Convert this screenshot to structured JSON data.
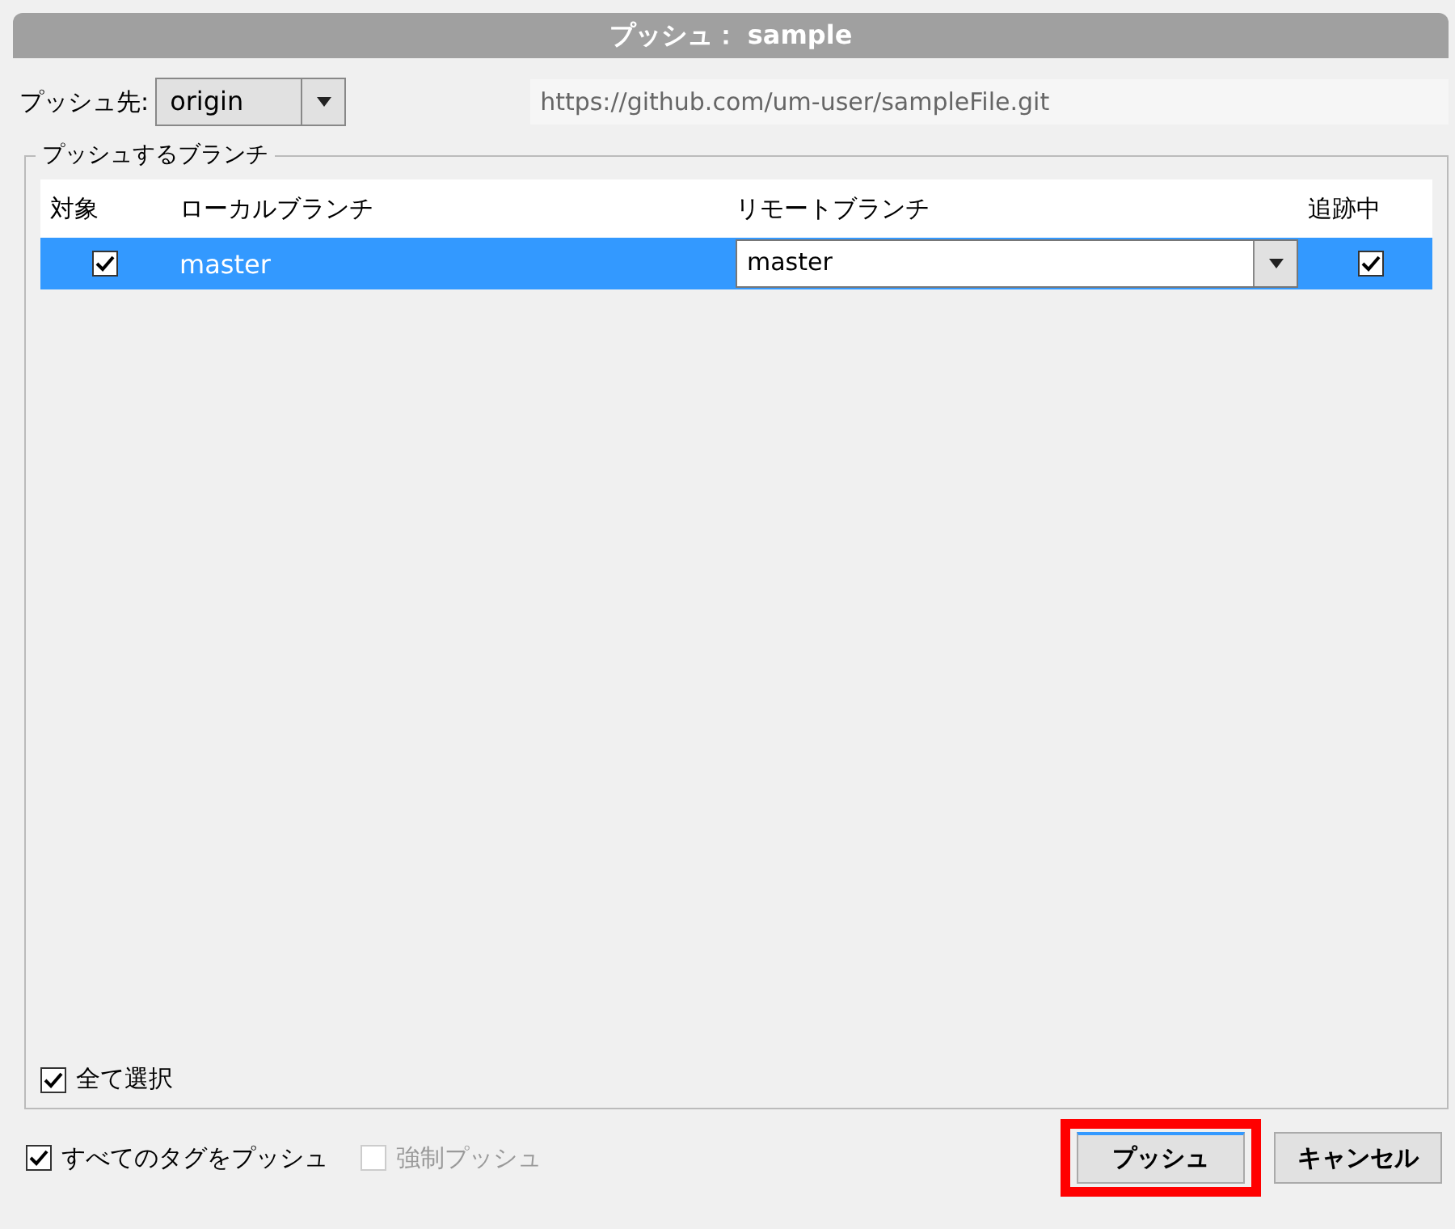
{
  "window": {
    "title": "プッシュ： sample"
  },
  "remote": {
    "label": "プッシュ先:",
    "value": "origin",
    "url": "https://github.com/um-user/sampleFile.git"
  },
  "branches": {
    "group_title": "プッシュするブランチ",
    "columns": [
      "対象",
      "ローカルブランチ",
      "リモートブランチ",
      "追跡中"
    ],
    "rows": [
      {
        "checked": true,
        "local": "master",
        "remote": "master",
        "tracking": true,
        "selected": true
      }
    ],
    "select_all": {
      "label": "全て選択",
      "checked": true
    }
  },
  "options": [
    {
      "label": "すべてのタグをプッシュ",
      "checked": true,
      "disabled": false
    },
    {
      "label": "強制プッシュ",
      "checked": false,
      "disabled": true
    }
  ],
  "buttons": [
    {
      "label": "プッシュ",
      "highlighted": true
    },
    {
      "label": "キャンセル",
      "highlighted": false
    }
  ]
}
